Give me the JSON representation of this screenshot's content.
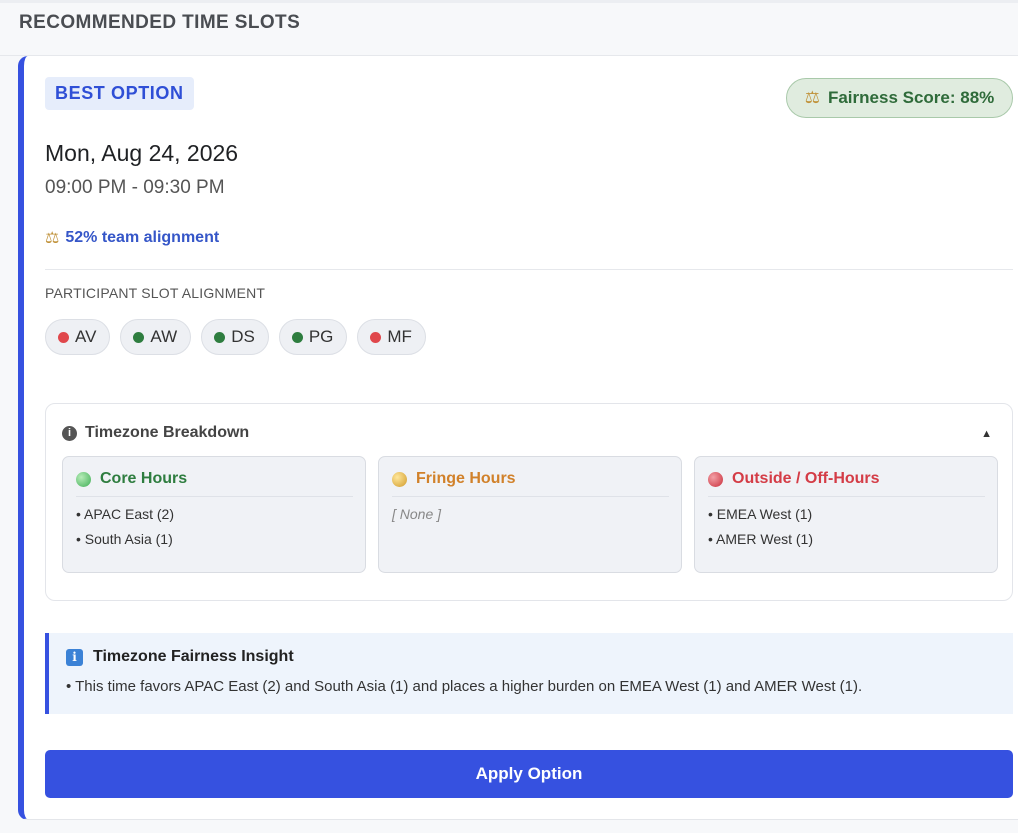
{
  "section": {
    "title": "RECOMMENDED TIME SLOTS"
  },
  "option": {
    "badge": "BEST OPTION",
    "fairness": "Fairness Score: 88%",
    "date": "Mon, Aug 24, 2026",
    "time": "09:00 PM - 09:30 PM",
    "alignment": "52% team alignment",
    "participant_title": "PARTICIPANT SLOT ALIGNMENT",
    "participants": [
      {
        "label": "AV",
        "status_color": "#e0474c"
      },
      {
        "label": "AW",
        "status_color": "#2e7d3f"
      },
      {
        "label": "DS",
        "status_color": "#2e7d3f"
      },
      {
        "label": "PG",
        "status_color": "#2e7d3f"
      },
      {
        "label": "MF",
        "status_color": "#e0474c"
      }
    ],
    "apply_label": "Apply Option"
  },
  "breakdown": {
    "title": "Timezone Breakdown",
    "core": {
      "title": "Core Hours",
      "color": "#2e7d3f",
      "items": [
        "• APAC East (2)",
        "• South Asia (1)"
      ]
    },
    "fringe": {
      "title": "Fringe Hours",
      "color": "#d1812a",
      "none": "[ None ]"
    },
    "outside": {
      "title": "Outside / Off-Hours",
      "color": "#d43c46",
      "items": [
        "• EMEA West (1)",
        "• AMER West (1)"
      ]
    }
  },
  "insight": {
    "title": "Timezone Fairness Insight",
    "text": "• This time favors APAC East (2) and South Asia (1) and places a higher burden on EMEA West (1) and AMER West (1)."
  },
  "icons": {
    "scale": "scale-icon",
    "info": "info-icon",
    "caret": "caret-up-icon",
    "insight": "info-square-icon"
  }
}
